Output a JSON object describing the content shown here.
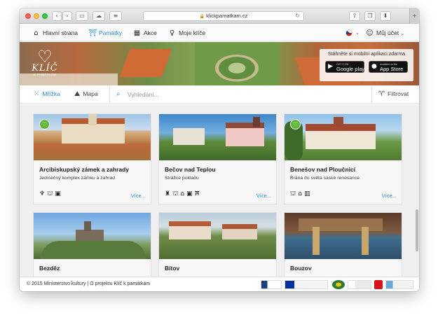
{
  "browser": {
    "url": "klickpamatkam.cz"
  },
  "nav": {
    "items": [
      {
        "label": "Hlavní strana",
        "icon": "home-icon"
      },
      {
        "label": "Památky",
        "icon": "monument-icon"
      },
      {
        "label": "Akce",
        "icon": "calendar-icon"
      },
      {
        "label": "Moje klíče",
        "icon": "location-pin-icon"
      }
    ],
    "account": "Můj účet"
  },
  "hero": {
    "logo_word": "KLÍČ",
    "logo_sub": "K PAMÁTKÁM",
    "app_text": "Stáhněte si mobilní aplikaci zdarma",
    "google_small": "GET IT ON",
    "google": "Google play",
    "apple_small": "Available on the",
    "apple": "App Store"
  },
  "filterbar": {
    "grid": "Mřížka",
    "map": "Mapa",
    "search_placeholder": "Vyhledání...",
    "filter": "Filtrovat"
  },
  "cards": [
    {
      "title": "Arcibiskupský zámek a zahrady",
      "subtitle": "Jedinečný komplex zámku a zahrad",
      "icons": "♆⛫▣",
      "more": "Více...",
      "favorite": true
    },
    {
      "title": "Bečov nad Teplou",
      "subtitle": "Strážce pokladu",
      "icons": "♜⛫⌂▣⛩",
      "more": "Více...",
      "favorite": false
    },
    {
      "title": "Benešov nad Ploučnicí",
      "subtitle": "Brána do světa saské renesance",
      "icons": "⛫⌂▥",
      "more": "Více...",
      "favorite": true
    },
    {
      "title": "Bezděz",
      "subtitle": "",
      "icons": "",
      "more": "",
      "favorite": false
    },
    {
      "title": "Bítov",
      "subtitle": "",
      "icons": "",
      "more": "",
      "favorite": false
    },
    {
      "title": "Bouzov",
      "subtitle": "",
      "icons": "",
      "more": "",
      "favorite": false
    }
  ],
  "footer": {
    "copyright": "© 2015 Ministerstvo kultury | O projektu Klíč k památkám"
  },
  "colors": {
    "accent": "#2a8fd9",
    "favorite": "#5cb836"
  }
}
